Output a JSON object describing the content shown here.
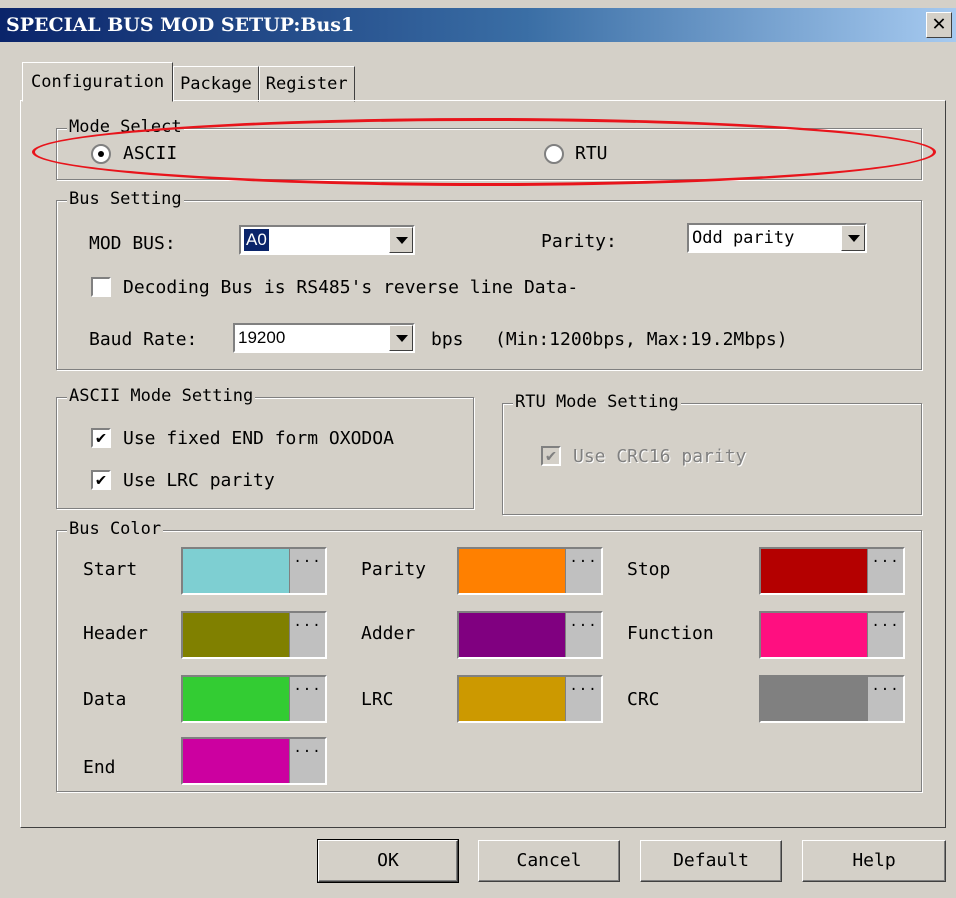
{
  "window": {
    "title": "SPECIAL BUS MOD SETUP:Bus1",
    "close_symbol": "✕"
  },
  "tabs": [
    {
      "label": "Configuration",
      "active": true
    },
    {
      "label": "Package",
      "active": false
    },
    {
      "label": "Register",
      "active": false
    }
  ],
  "mode_select": {
    "legend": "Mode Select",
    "options": [
      {
        "label": "ASCII",
        "checked": true
      },
      {
        "label": "RTU",
        "checked": false
      }
    ]
  },
  "bus_setting": {
    "legend": "Bus Setting",
    "mod_bus_label": "MOD BUS:",
    "mod_bus_value": "A0",
    "parity_label": "Parity:",
    "parity_value": "Odd parity",
    "reverse_checkbox_label": "Decoding Bus is RS485's reverse line Data-",
    "reverse_checked": false,
    "baud_label": "Baud Rate:",
    "baud_value": "19200",
    "baud_unit": "bps",
    "baud_range_note": "(Min:1200bps, Max:19.2Mbps)"
  },
  "ascii_mode": {
    "legend": "ASCII Mode Setting",
    "fixed_end_label": "Use fixed END form OXODOA",
    "fixed_end_checked": true,
    "lrc_label": "Use LRC parity",
    "lrc_checked": true
  },
  "rtu_mode": {
    "legend": "RTU Mode Setting",
    "crc_label": "Use CRC16 parity",
    "crc_checked": true,
    "crc_disabled": true
  },
  "bus_color": {
    "legend": "Bus Color",
    "more_symbol": "···",
    "items": [
      {
        "label": "Start",
        "color": "#7ecfd2"
      },
      {
        "label": "Parity",
        "color": "#ff8000"
      },
      {
        "label": "Stop",
        "color": "#b40000"
      },
      {
        "label": "Header",
        "color": "#808000"
      },
      {
        "label": "Adder",
        "color": "#800080"
      },
      {
        "label": "Function",
        "color": "#ff0f80"
      },
      {
        "label": "Data",
        "color": "#33cc33"
      },
      {
        "label": "LRC",
        "color": "#cc9900"
      },
      {
        "label": "CRC",
        "color": "#808080"
      },
      {
        "label": "End",
        "color": "#cc00a0"
      }
    ]
  },
  "buttons": {
    "ok": "OK",
    "cancel": "Cancel",
    "default": "Default",
    "help": "Help"
  },
  "check_mark": "✔"
}
